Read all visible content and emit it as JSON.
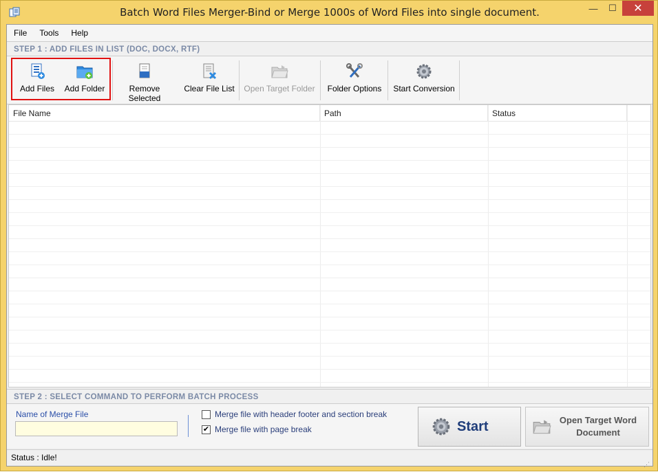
{
  "window": {
    "title": "Batch Word Files Merger-Bind or Merge 1000s of Word Files into single document.",
    "min_glyph": "—",
    "max_glyph": "☐",
    "close_glyph": "✕"
  },
  "menu": [
    "File",
    "Tools",
    "Help"
  ],
  "step1": {
    "label": "STEP 1 : ADD FILES IN LIST (DOC, DOCX, RTF)"
  },
  "toolbar": {
    "add_files": "Add Files",
    "add_folder": "Add Folder",
    "remove_selected": "Remove Selected",
    "clear_file_list": "Clear File List",
    "open_target_folder": "Open Target Folder",
    "folder_options": "Folder Options",
    "start_conversion": "Start Conversion",
    "icons": [
      "add-files-icon",
      "add-folder-icon",
      "remove-selected-icon",
      "clear-file-list-icon",
      "open-target-folder-icon",
      "folder-options-icon",
      "start-conversion-icon"
    ]
  },
  "grid": {
    "columns": [
      "File Name",
      "Path",
      "Status"
    ],
    "rows": []
  },
  "step2": {
    "label": "STEP 2 : SELECT COMMAND TO PERFORM BATCH PROCESS",
    "merge_file_label": "Name of Merge File",
    "merge_file_value": "",
    "option_header_footer": "Merge file with header footer and section break",
    "option_header_footer_checked": false,
    "option_page_break": "Merge file with page break",
    "option_page_break_checked": true,
    "start_label": "Start",
    "open_target_label": "Open Target Word Document"
  },
  "status": {
    "text": "Status  :  Idle!"
  },
  "colors": {
    "frame": "#f5d36c",
    "close": "#c7413b",
    "highlight": "#e01010",
    "step_text": "#7b8aa6"
  }
}
